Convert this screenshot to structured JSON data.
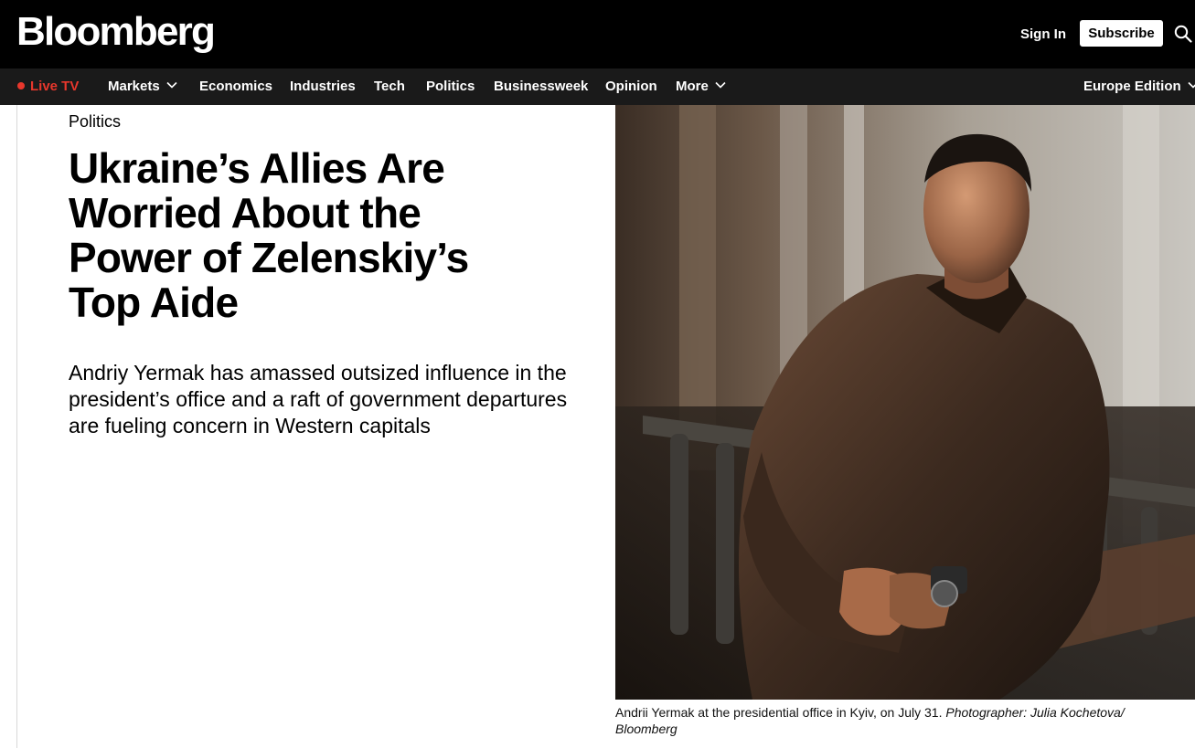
{
  "header": {
    "logo": "Bloomberg",
    "signin_label": "Sign In",
    "subscribe_label": "Subscribe",
    "search_icon": "search-icon"
  },
  "nav": {
    "live_label": "Live TV",
    "items": [
      {
        "label": "Markets",
        "has_dropdown": true
      },
      {
        "label": "Economics"
      },
      {
        "label": "Industries"
      },
      {
        "label": "Tech"
      },
      {
        "label": "Politics"
      },
      {
        "label": "Businessweek"
      },
      {
        "label": "Opinion"
      },
      {
        "label": "More",
        "has_dropdown": true
      }
    ],
    "edition_label": "Europe Edition"
  },
  "article": {
    "section": "Politics",
    "headline": "Ukraine’s Allies Are Worried About the Power of Zelenskiy’s Top Aide",
    "dek": "Andriy Yermak has amassed outsized influence in the president’s office and a raft of government departures are fueling concern in Western capitals",
    "caption_text": "Andrii Yermak at the presidential office in Kyiv, on July 31.",
    "caption_credit": "Photographer: Julia Kochetova/ Bloomberg"
  },
  "colors": {
    "topbar_bg": "#000000",
    "navbar_bg": "#1a1a1a",
    "live_red": "#e8372c"
  }
}
